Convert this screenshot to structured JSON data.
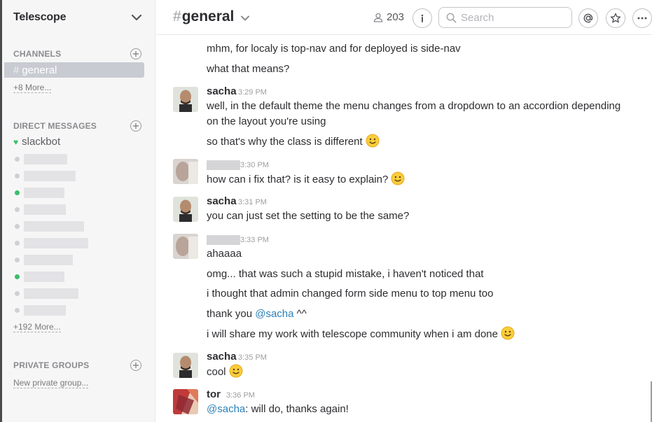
{
  "sidebar": {
    "team_name": "Telescope",
    "channels_title": "CHANNELS",
    "active_channel": "general",
    "channels_more": "+8 More...",
    "dm_title": "DIRECT MESSAGES",
    "slackbot": "slackbot",
    "dm_more": "+192 More...",
    "groups_title": "PRIVATE GROUPS",
    "new_group": "New private group...",
    "dm_presence": [
      "away",
      "away",
      "online",
      "away",
      "away",
      "away",
      "away",
      "online",
      "away",
      "away"
    ]
  },
  "header": {
    "channel_name": "general",
    "member_count": "203",
    "search_placeholder": "Search"
  },
  "messages": {
    "m1": "mhm, for localy is top-nav and for deployed is side-nav",
    "m2": "what that means?",
    "g1": {
      "author": "sacha",
      "time": "3:29 PM",
      "l1": "well, in the default theme the menu changes from a dropdown to an accordion depending on the layout you're using",
      "l2": "so that's why the class is different"
    },
    "g2": {
      "time": "3:30 PM",
      "l1": "how can i fix that? is it easy to explain?"
    },
    "g3": {
      "author": "sacha",
      "time": "3:31 PM",
      "l1": "you can just set the setting to be the same?"
    },
    "g4": {
      "time": "3:33 PM",
      "l1": "ahaaaa",
      "l2": "omg... that was such a stupid mistake, i haven't noticed that",
      "l3": "i thought that admin changed form side menu to top menu too",
      "l4_pre": "thank you ",
      "l4_mention": "@sacha",
      "l4_post": " ^^",
      "l5": "i will share my work with telescope community when i am done"
    },
    "g5": {
      "author": "sacha",
      "time": "3:35 PM",
      "l1": "cool"
    },
    "g6": {
      "author": "tor",
      "time": "3:36 PM",
      "mention": "@sacha",
      "rest": ": will do, thanks again!"
    }
  },
  "colors": {
    "mention": "#2a80b9",
    "online": "#3cbc6c",
    "active_channel_bg": "#c8cbd2"
  }
}
